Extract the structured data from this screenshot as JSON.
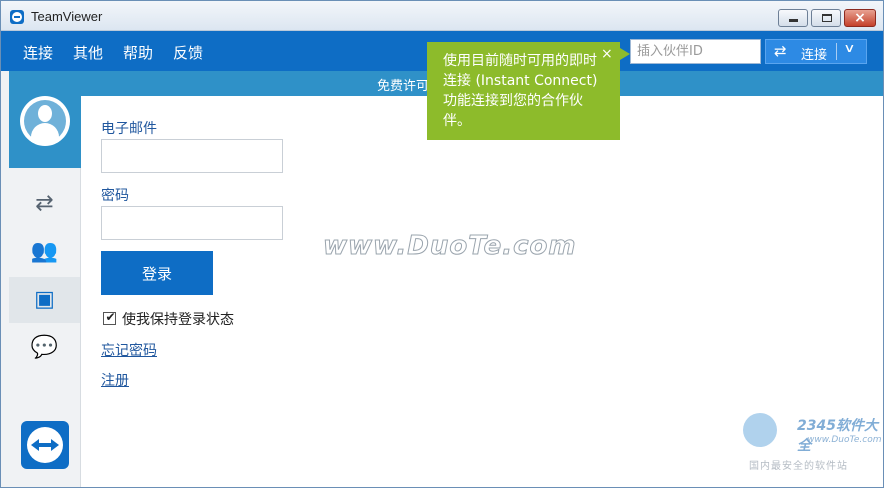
{
  "window": {
    "title": "TeamViewer",
    "close_glyph": "×"
  },
  "menu": {
    "items": [
      "连接",
      "其他",
      "帮助",
      "反馈"
    ]
  },
  "partner": {
    "placeholder": "插入伙伴ID",
    "value": ""
  },
  "connect": {
    "icon": "swap-arrows-icon",
    "arrows_glyph": "⇄",
    "label": "连接",
    "dropdown_glyph": "∨"
  },
  "license_strip": {
    "text": "免费许可"
  },
  "tooltip": {
    "text": "使用目前随时可用的即时连接 (Instant Connect) 功能连接到您的合作伙伴。",
    "close_glyph": "×",
    "color": "#8dbb2b"
  },
  "sidebar": {
    "avatar_icon": "user-avatar-icon",
    "items": [
      {
        "icon": "remote-control-icon",
        "glyph": "⇄",
        "active": false
      },
      {
        "icon": "meeting-icon",
        "glyph": "👥",
        "active": false
      },
      {
        "icon": "contacts-icon",
        "glyph": "▣",
        "active": true
      },
      {
        "icon": "chat-icon",
        "glyph": "💬",
        "active": false
      }
    ],
    "logo_icon": "teamviewer-logo-icon"
  },
  "form": {
    "email_label": "电子邮件",
    "email_value": "",
    "password_label": "密码",
    "password_value": "",
    "login_label": "登录",
    "remember_checked": true,
    "remember_check_glyph": "✔",
    "remember_label": "使我保持登录状态",
    "forgot_link": "忘记密码",
    "register_link": "注册"
  },
  "watermark": {
    "text": "www.DuoTe.com",
    "corner_title": "2345软件大全",
    "corner_url": "www.DuoTe.com",
    "corner_sub": "国内最安全的软件站"
  },
  "colors": {
    "brand_blue": "#0e6dc5",
    "strip_blue": "#2f91c8",
    "link_blue": "#20579e"
  }
}
